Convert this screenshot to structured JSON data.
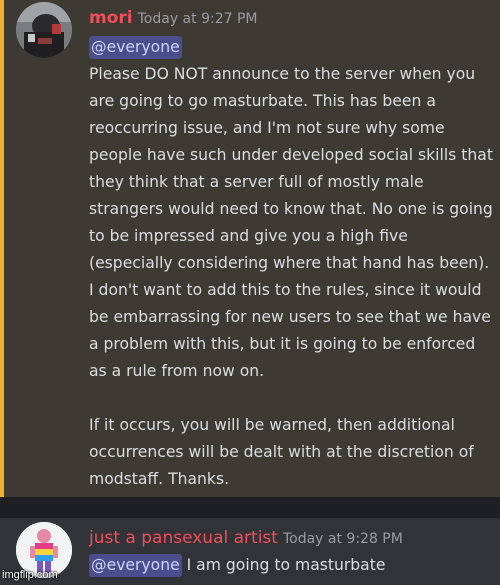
{
  "messages": [
    {
      "author": "mori",
      "timestamp": "Today at 9:27 PM",
      "mention": "@everyone",
      "paragraphs": [
        "Please DO NOT announce to the server when you are going to go masturbate. This has been a reoccurring issue, and I'm not sure why some people have such under developed social skills that they think that a server full of mostly male strangers would need to know that. No one is going to be impressed and give you a high five (especially considering where that hand has been). I don't want to add this to the rules, since it would be embarrassing for new users to see that we have a problem with this, but it is going to be enforced as a rule from now on.",
        "If it occurs, you will be warned, then additional occurrences will be dealt with at the discretion of modstaff. Thanks."
      ],
      "author_color": "#f04e59",
      "highlight_color": "#f0b132"
    },
    {
      "author": "just a pansexual artist",
      "timestamp": "Today at 9:28 PM",
      "mention": "@everyone",
      "text": " I am going to masturbate",
      "author_color": "#f04e59"
    }
  ],
  "watermark": "imgflip.com",
  "colors": {
    "background": "#313338",
    "mention_bg": "#4a4e8c",
    "mention_text": "#cfd4ff"
  }
}
